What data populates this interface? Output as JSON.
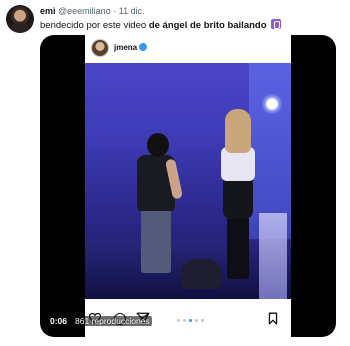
{
  "tweet": {
    "author_name": "emi",
    "author_handle": "@eeemiliano",
    "separator": "·",
    "date": "11 dic.",
    "text_plain": "bendecido por este video ",
    "text_bold": "de ángel de brito bailando",
    "emoji_icon": "pray-emoji-icon"
  },
  "embedded_post": {
    "username": "jmena",
    "verified_icon": "verified-badge-icon"
  },
  "video": {
    "elapsed": "0:06",
    "views": "861 reproducciones"
  },
  "colors": {
    "link_blue": "#3897f0",
    "text": "#0f1419",
    "muted": "#536471",
    "emoji_purple": "#8e5bd6"
  }
}
